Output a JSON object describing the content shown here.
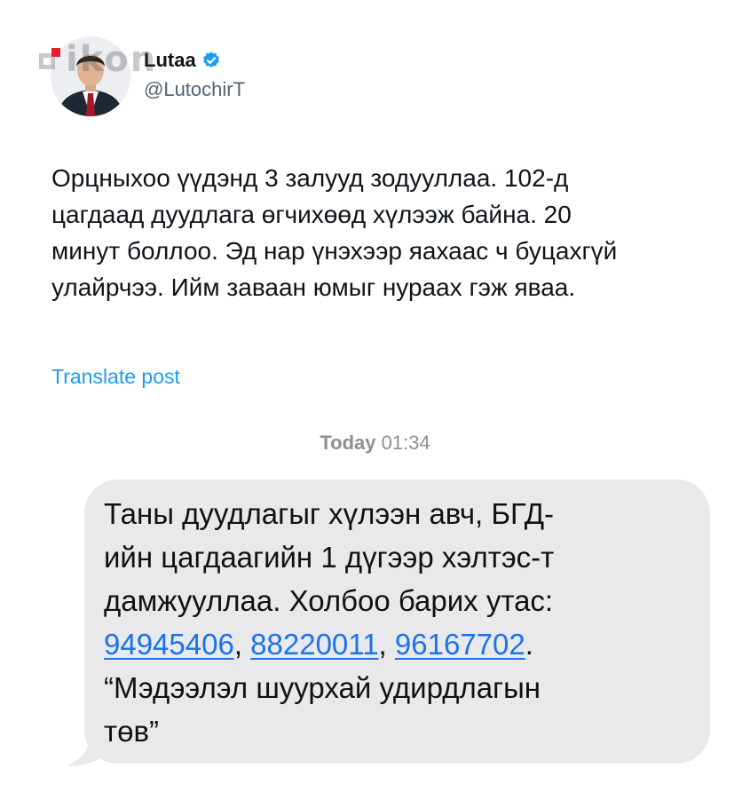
{
  "watermark": {
    "text": "ikon"
  },
  "profile": {
    "display_name": "Lutaa",
    "handle": "@LutochirT",
    "verified": true
  },
  "post": {
    "lines": [
      "Орцныхоо үүдэнд 3 залууд зодууллаа. 102-д",
      "цагдаад дуудлага өгчихөөд хүлээж байна. 20",
      "минут боллоо. Эд нар үнэхээр яахаас ч буцахгүй",
      "улайрчээ. Ийм заваан юмыг нураах гэж яваа."
    ],
    "translate_label": "Translate post"
  },
  "sms": {
    "timestamp_day": "Today",
    "timestamp_time": "01:34",
    "line1": "Таны дуудлагыг хүлээн авч, БГД-",
    "line2": "ийн цагдаагийн 1 дүгээр хэлтэс-т",
    "line3": "дамжууллаа. Холбоо барих утас:",
    "phones": [
      "94945406",
      "88220011",
      "96167702"
    ],
    "sep1": ", ",
    "sep2": ", ",
    "end_punct": ".",
    "line5": "“Мэдээлэл шуурхай удирдлагын",
    "line6": "төв”"
  },
  "colors": {
    "link_blue": "#1d9bf0",
    "verified_blue": "#1d9bf0",
    "phone_link_blue": "#1a73e8",
    "bubble_gray": "#e9e9eb"
  }
}
